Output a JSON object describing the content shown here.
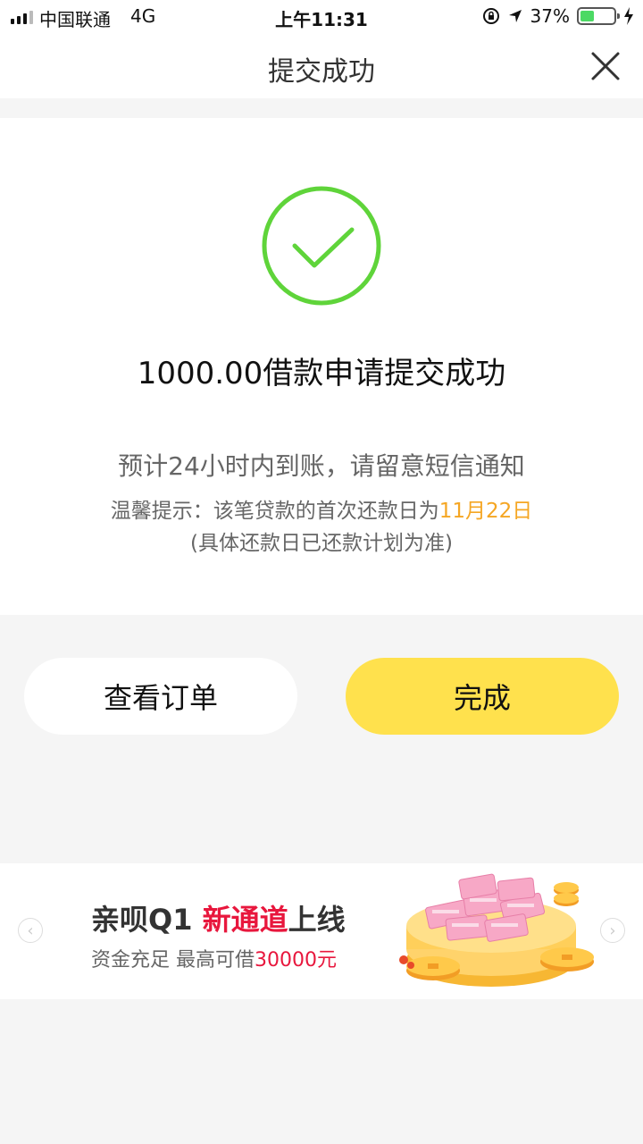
{
  "status_bar": {
    "carrier": "中国联通",
    "network": "4G",
    "time": "上午11:31",
    "battery": "37%",
    "battery_level": 0.37
  },
  "nav": {
    "title": "提交成功"
  },
  "result": {
    "title": "1000.00借款申请提交成功",
    "subtitle": "预计24小时内到账，请留意短信通知",
    "tip_prefix": "温馨提示：该笔贷款的首次还款日为",
    "tip_date": "11月22日",
    "tip_note": "(具体还款日已还款计划为准)"
  },
  "buttons": {
    "view_order": "查看订单",
    "done": "完成"
  },
  "banner": {
    "headline_part1": "亲呗Q1 ",
    "headline_red": "新通道",
    "headline_part2": "上线",
    "sub_part1": "资金充足 最高可借",
    "sub_red": "30000元",
    "arrow_left": "‹",
    "arrow_right": "›"
  },
  "colors": {
    "accent_yellow": "#ffe14d",
    "success_green": "#5fd43a",
    "highlight_orange": "#f5a623",
    "promo_red": "#e8173d"
  }
}
